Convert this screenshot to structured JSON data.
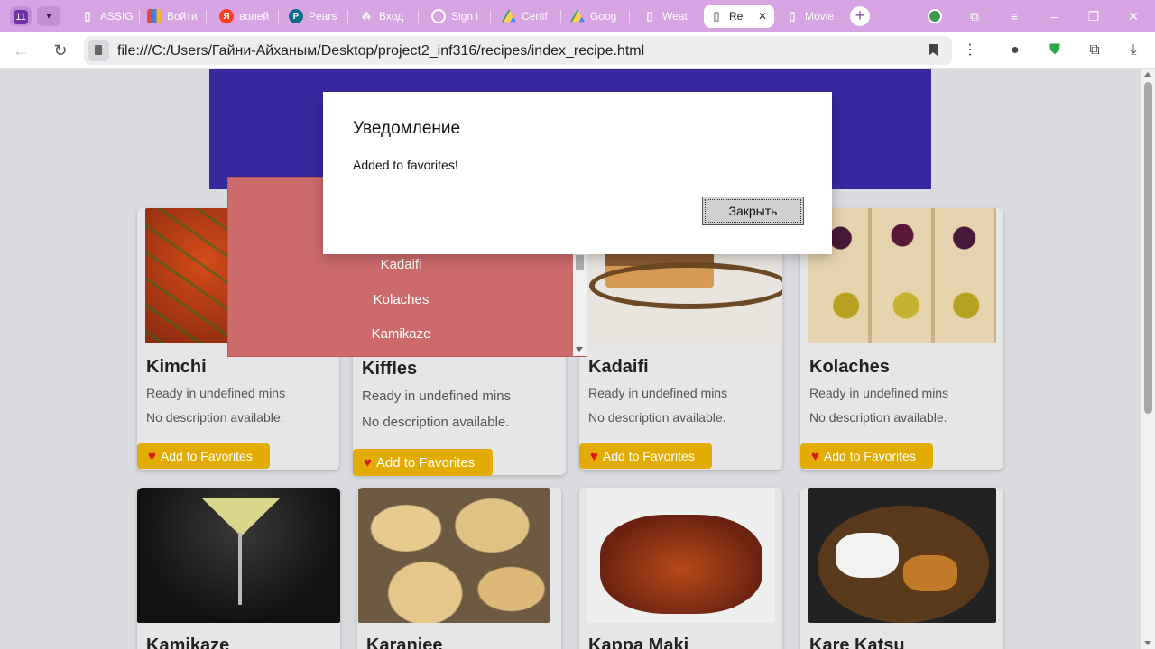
{
  "browser": {
    "tab_count": "11",
    "tabs": [
      {
        "title": "ASSIG",
        "favicon": "document-icon",
        "color": "#ffffff"
      },
      {
        "title": "Войти",
        "favicon": "bar-chart-icon",
        "color": "#e24b3b"
      },
      {
        "title": "волей",
        "favicon": "yandex-icon",
        "color": "#fc3f1d"
      },
      {
        "title": "Pears",
        "favicon": "pearson-icon",
        "color": "#0a6b8a"
      },
      {
        "title": "Вход",
        "favicon": "sitemap-icon",
        "color": "#ffffff"
      },
      {
        "title": "Sign i",
        "favicon": "github-icon",
        "color": "#ffffff"
      },
      {
        "title": "Certif",
        "favicon": "google-drive-icon",
        "color": "#1fa463"
      },
      {
        "title": "Goog",
        "favicon": "google-drive-icon",
        "color": "#1fa463"
      },
      {
        "title": "Weat",
        "favicon": "document-icon",
        "color": "#ffffff"
      },
      {
        "title": "Re",
        "favicon": "document-icon",
        "color": "#888888"
      },
      {
        "title": "Movie",
        "favicon": "document-icon",
        "color": "#ffffff"
      }
    ],
    "address": "file:///C:/Users/Гайни-Айханым/Desktop/project2_inf316/recipes/index_recipe.html"
  },
  "dropdown": {
    "items": [
      "Kadaifi",
      "Kolaches",
      "Kamikaze"
    ]
  },
  "cards": [
    {
      "title": "Kimchi",
      "time": "Ready in undefined mins",
      "desc": "No description available.",
      "button": "Add to Favorites"
    },
    {
      "title": "Kiffles",
      "time": "Ready in undefined mins",
      "desc": "No description available.",
      "button": "Add to Favorites"
    },
    {
      "title": "Kadaifi",
      "time": "Ready in undefined mins",
      "desc": "No description available.",
      "button": "Add to Favorites"
    },
    {
      "title": "Kolaches",
      "time": "Ready in undefined mins",
      "desc": "No description available.",
      "button": "Add to Favorites"
    },
    {
      "title": "Kamikaze"
    },
    {
      "title": "Karanjee"
    },
    {
      "title": "Kappa Maki"
    },
    {
      "title": "Kare Katsu"
    }
  ],
  "modal": {
    "title": "Уведомление",
    "message": "Added to favorites!",
    "close_label": "Закрыть"
  },
  "colors": {
    "tab_strip": "#d9a4e4",
    "hero": "#3828a0",
    "favorite_button": "#e3ac05",
    "dropdown": "#cd6b6b"
  }
}
